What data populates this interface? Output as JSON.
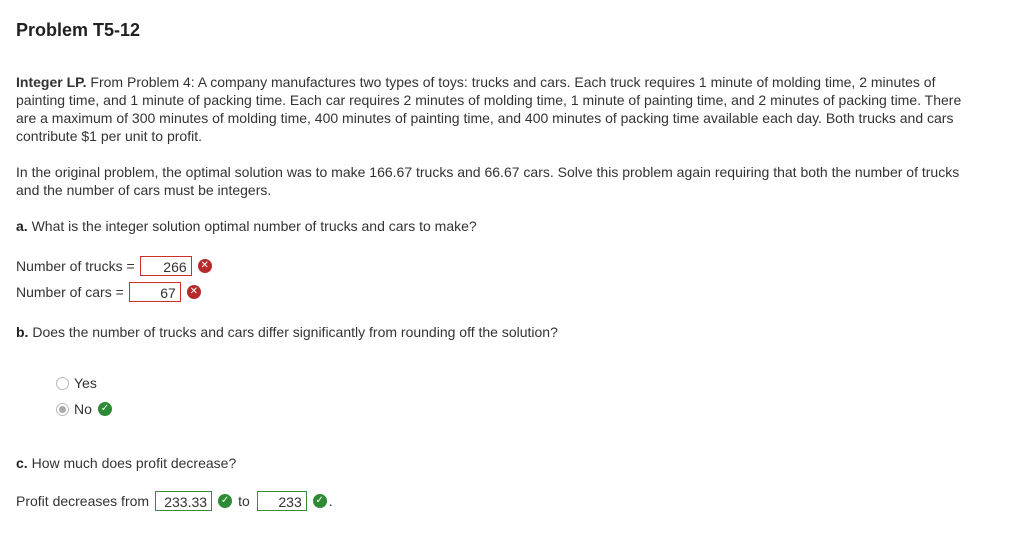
{
  "title": "Problem T5-12",
  "intro": {
    "bold": "Integer LP.",
    "text": " From Problem 4: A company manufactures two types of toys: trucks and cars. Each truck requires 1 minute of molding time, 2 minutes of painting time, and 1 minute of packing time. Each car requires 2 minutes of molding time, 1 minute of painting time, and 2 minutes of packing time. There are a maximum of 300 minutes of molding time, 400 minutes of painting time, and 400 minutes of packing time available each day. Both trucks and cars contribute $1 per unit to profit."
  },
  "context": "In the original problem, the optimal solution was to make 166.67 trucks and 66.67 cars. Solve this problem again requiring that both the number of trucks and the number of cars must be integers.",
  "part_a": {
    "label": "a.",
    "question": " What is the integer solution optimal number of trucks and cars to make?",
    "trucks_label": "Number of trucks =",
    "trucks_value": "266",
    "cars_label": "Number of cars =",
    "cars_value": "67"
  },
  "part_b": {
    "label": "b.",
    "question": " Does the number of trucks and cars differ significantly from rounding off the solution?",
    "options": [
      "Yes",
      "No"
    ],
    "selected": "No"
  },
  "part_c": {
    "label": "c.",
    "question": " How much does profit decrease?",
    "prefix": "Profit decreases from",
    "from_value": "233.33",
    "middle": "to",
    "to_value": "233",
    "suffix": "."
  },
  "colors": {
    "incorrect": "#b52a2a",
    "correct": "#2e8b35"
  }
}
